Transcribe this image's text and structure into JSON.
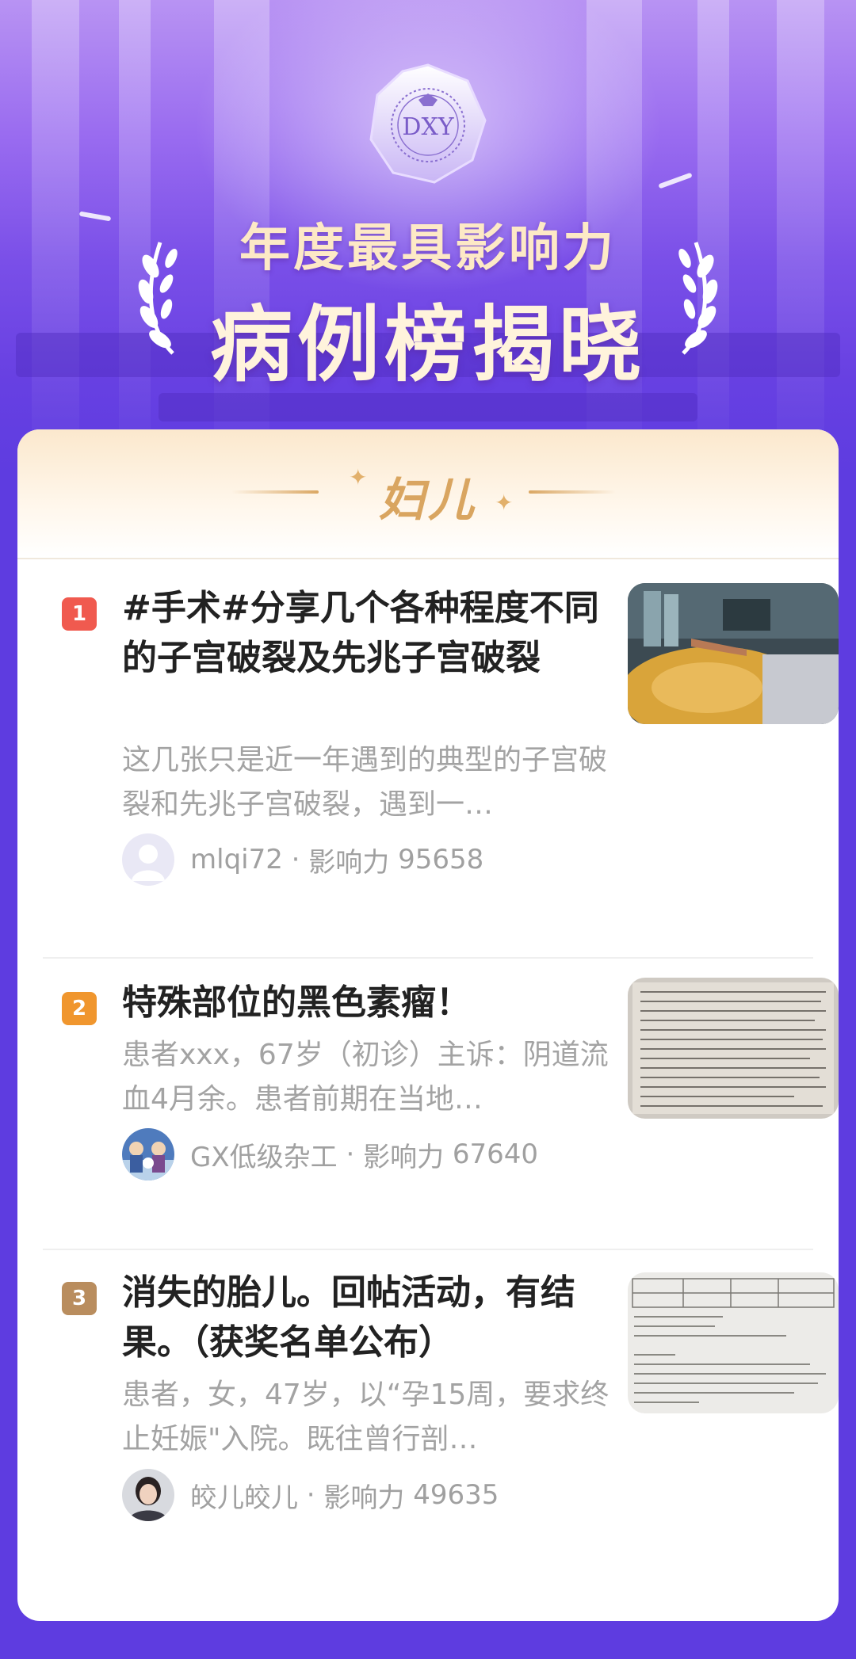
{
  "hero": {
    "badge_text": "DXY",
    "title_line1": "年度最具影响力",
    "title_line2": "病例榜揭晓"
  },
  "category": {
    "title": "妇儿"
  },
  "items": [
    {
      "rank": "1",
      "rank_color": "#f05a4f",
      "title": "#手术#分享几个各种程度不同的子宫破裂及先兆子宫破裂",
      "summary": "这几张只是近一年遇到的典型的子宫破裂和先兆子宫破裂，遇到一…",
      "author": "mlqi72",
      "influence_label": "影响力",
      "influence": "95658",
      "avatar_icon": "default-user-avatar-icon",
      "thumbnail": "surgery-photo"
    },
    {
      "rank": "2",
      "rank_color": "#f0962e",
      "title": "特殊部位的黑色素瘤！",
      "summary": "患者xxx，67岁（初诊）主诉：阴道流血4月余。患者前期在当地…",
      "author": "GX低级杂工",
      "influence_label": "影响力",
      "influence": "67640",
      "avatar_icon": "cartoon-characters-avatar",
      "thumbnail": "scanned-document-photo"
    },
    {
      "rank": "3",
      "rank_color": "#b98d5e",
      "title": "消失的胎儿。回帖活动，有结果。（获奖名单公布）",
      "summary": "患者，女，47岁，以“孕15周，要求终止妊娠\"入院。既往曾行剖…",
      "author": "皎儿皎儿",
      "influence_label": "影响力",
      "influence": "49635",
      "avatar_icon": "portrait-photo-avatar",
      "thumbnail": "ultrasound-report-photo"
    }
  ]
}
